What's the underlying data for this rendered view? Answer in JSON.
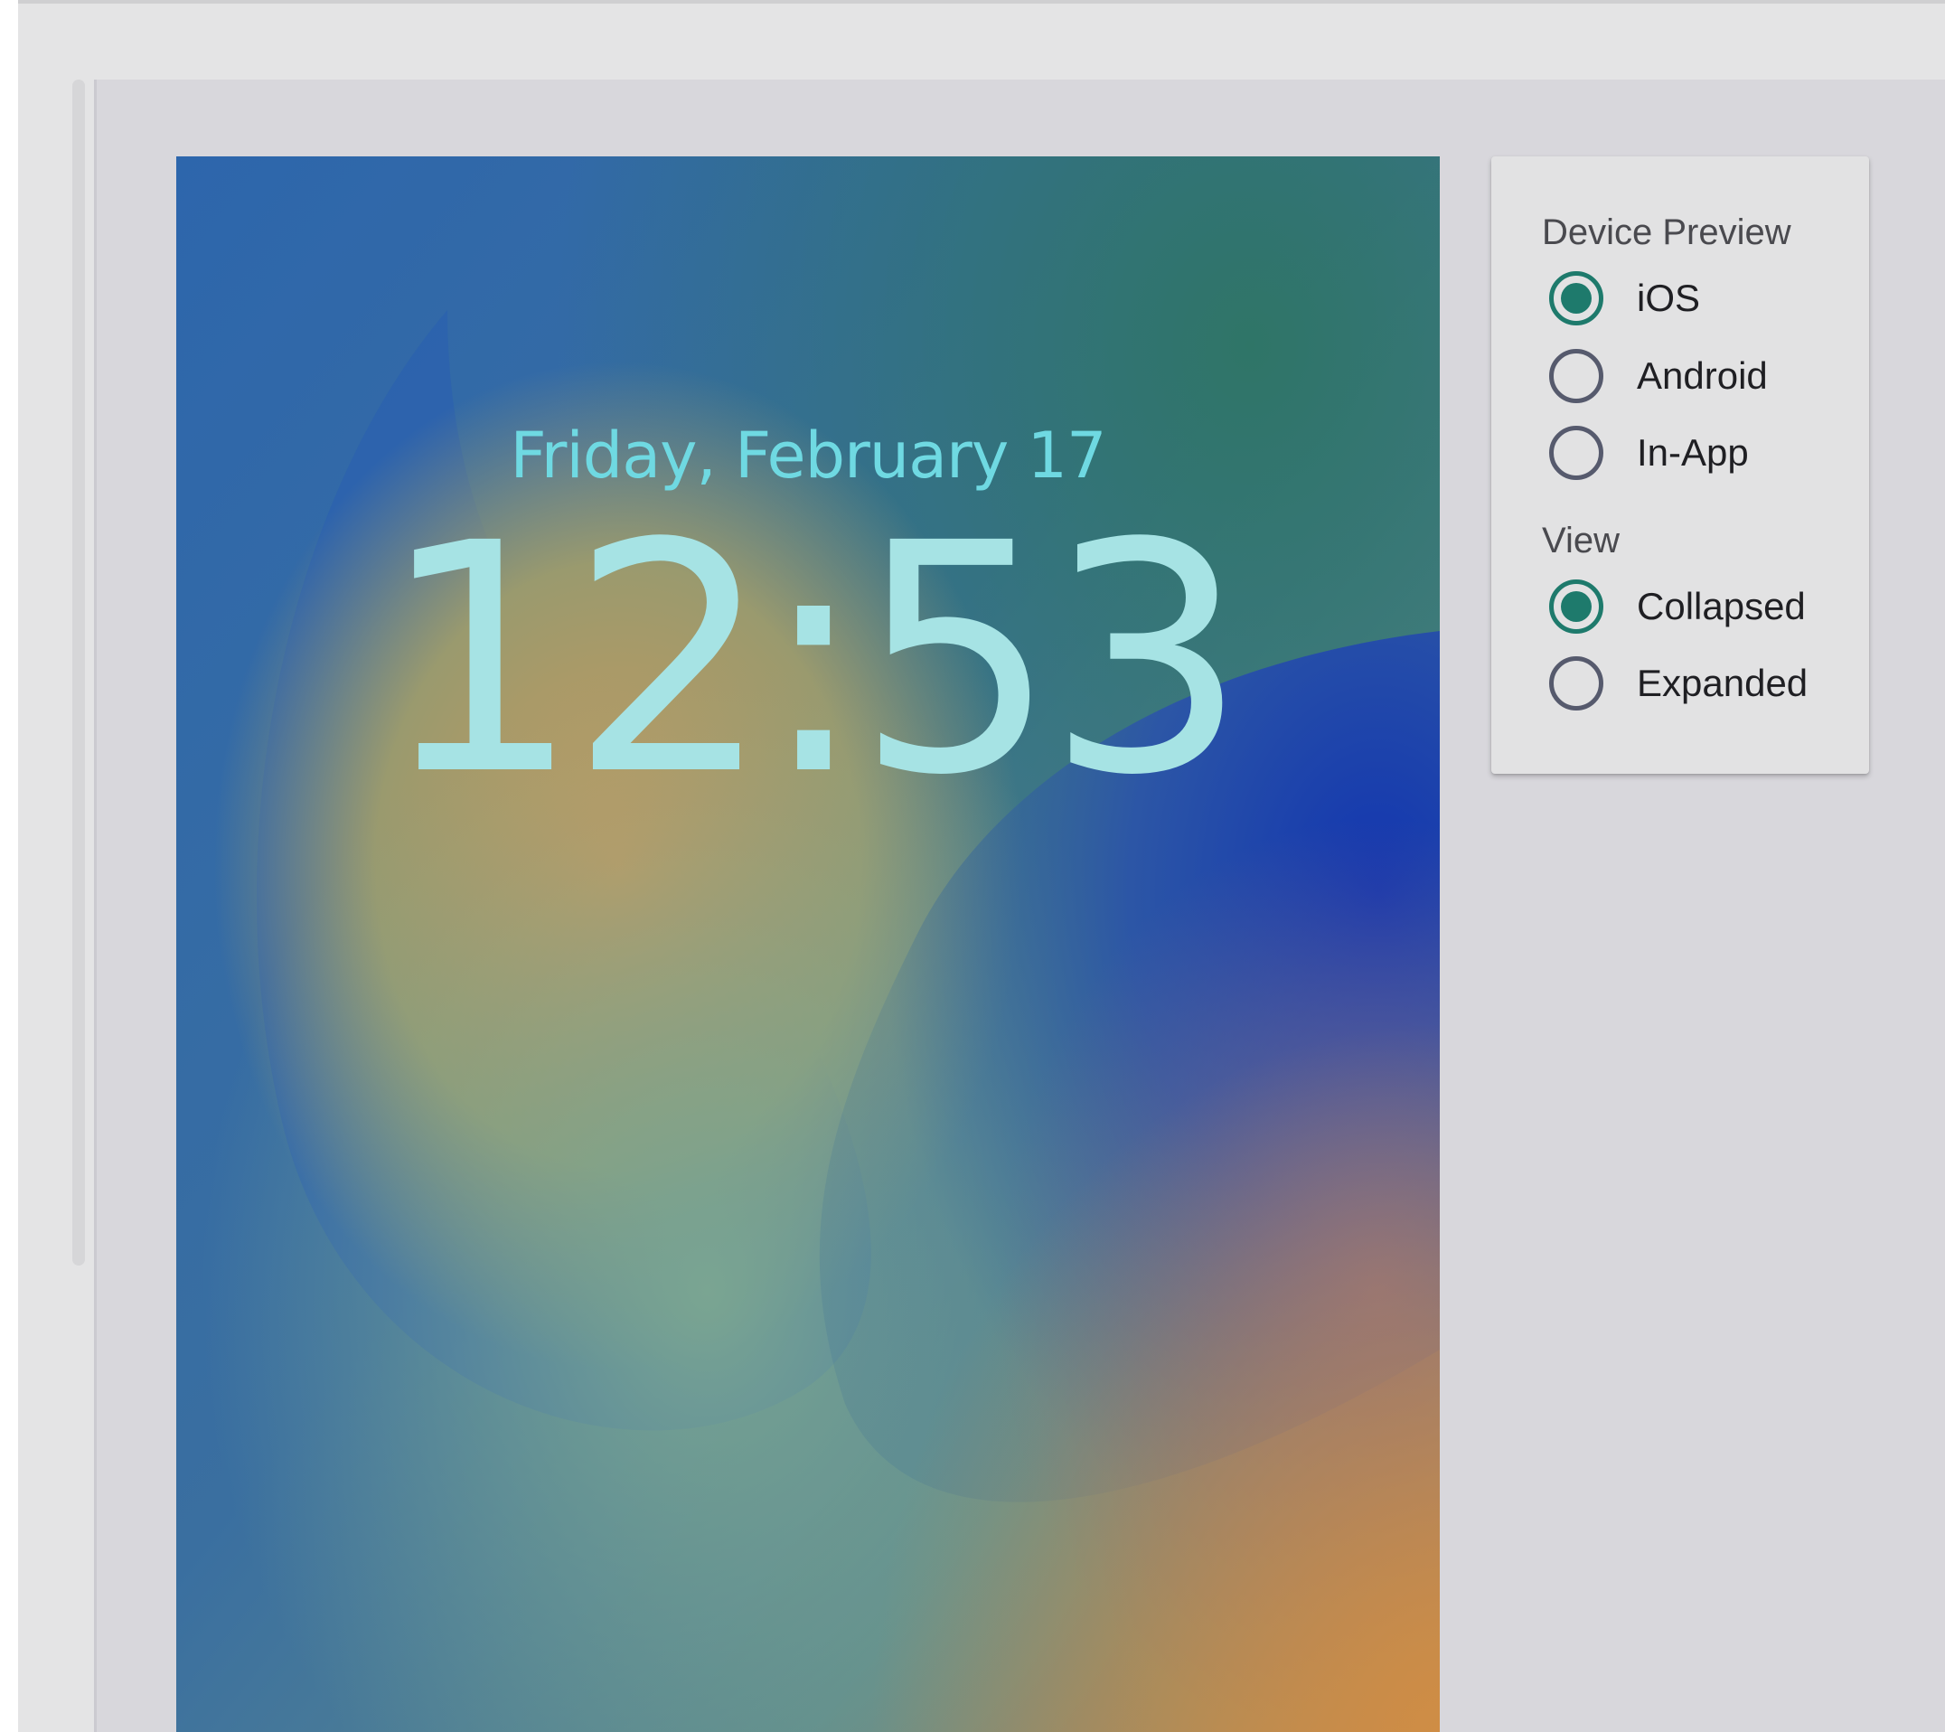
{
  "lock_screen": {
    "date": "Friday, February 17",
    "time": "12:53"
  },
  "options": {
    "device_preview": {
      "label": "Device Preview",
      "options": [
        {
          "label": "iOS",
          "selected": true
        },
        {
          "label": "Android",
          "selected": false
        },
        {
          "label": "In-App",
          "selected": false
        }
      ]
    },
    "view": {
      "label": "View",
      "options": [
        {
          "label": "Collapsed",
          "selected": true
        },
        {
          "label": "Expanded",
          "selected": false
        }
      ]
    }
  },
  "colors": {
    "accent": "#1e7a6c",
    "panel_bg": "#d8d7dc",
    "card_bg": "#e2e2e3"
  }
}
